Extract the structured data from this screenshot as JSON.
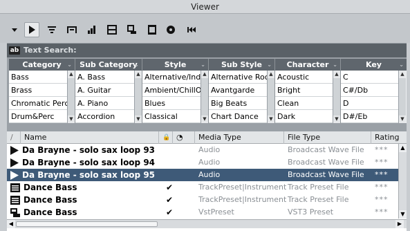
{
  "window": {
    "title": "Viewer"
  },
  "toolbar": {
    "buttons": [
      {
        "name": "menu-arrow-icon"
      },
      {
        "name": "play-icon"
      },
      {
        "name": "list-view-icon"
      },
      {
        "name": "filter-view-icon"
      },
      {
        "name": "level-meter-icon"
      },
      {
        "name": "results-icon"
      },
      {
        "name": "preview-icon"
      },
      {
        "name": "column-icon"
      },
      {
        "name": "mediabay-icon"
      },
      {
        "name": "rewind-icon"
      }
    ]
  },
  "text_search": {
    "label": "Text Search:",
    "icon_text": "ab"
  },
  "filters": [
    {
      "header": "Category",
      "items": [
        "Bass",
        "Brass",
        "Chromatic Perc",
        "Drum&Perc"
      ]
    },
    {
      "header": "Sub Category",
      "items": [
        "A. Bass",
        "A. Guitar",
        "A. Piano",
        "Accordion"
      ]
    },
    {
      "header": "Style",
      "items": [
        "Alternative/Indie",
        "Ambient/ChillOut",
        "Blues",
        "Classical"
      ]
    },
    {
      "header": "Sub Style",
      "items": [
        "Alternative Rock",
        "Avantgarde",
        "Big Beats",
        "Chart Dance"
      ]
    },
    {
      "header": "Character",
      "items": [
        "Acoustic",
        "Bright",
        "Clean",
        "Dark"
      ]
    },
    {
      "header": "Key",
      "items": [
        "C",
        "C#/Db",
        "D",
        "D#/Eb"
      ]
    }
  ],
  "results": {
    "columns": {
      "sort": "/",
      "name": "Name",
      "lock": "🔒",
      "clock": "◔",
      "media_type": "Media Type",
      "file_type": "File Type",
      "rating": "Rating"
    },
    "rows": [
      {
        "icon": "audio-icon",
        "name": "Da Brayne - solo sax loop 93",
        "check": "",
        "media_type": "Audio",
        "file_type": "Broadcast Wave File",
        "rating": "***"
      },
      {
        "icon": "audio-icon",
        "name": "Da Brayne - solo sax loop 94",
        "check": "",
        "media_type": "Audio",
        "file_type": "Broadcast Wave File",
        "rating": "***"
      },
      {
        "icon": "audio-icon",
        "name": "Da Brayne - solo sax loop 95",
        "check": "",
        "media_type": "Audio",
        "file_type": "Broadcast Wave File",
        "rating": "***",
        "selected": true
      },
      {
        "icon": "track-preset-icon",
        "name": "Dance Bass",
        "check": "✔",
        "media_type": "TrackPreset|Instrument",
        "file_type": "Track Preset File",
        "rating": "***"
      },
      {
        "icon": "track-preset-icon",
        "name": "Dance Bass",
        "check": "✔",
        "media_type": "TrackPreset|Instrument",
        "file_type": "Track Preset File",
        "rating": "***"
      },
      {
        "icon": "vst-preset-icon",
        "name": "Dance Bass",
        "check": "✔",
        "media_type": "VstPreset",
        "file_type": "VST3 Preset",
        "rating": "***"
      }
    ]
  }
}
